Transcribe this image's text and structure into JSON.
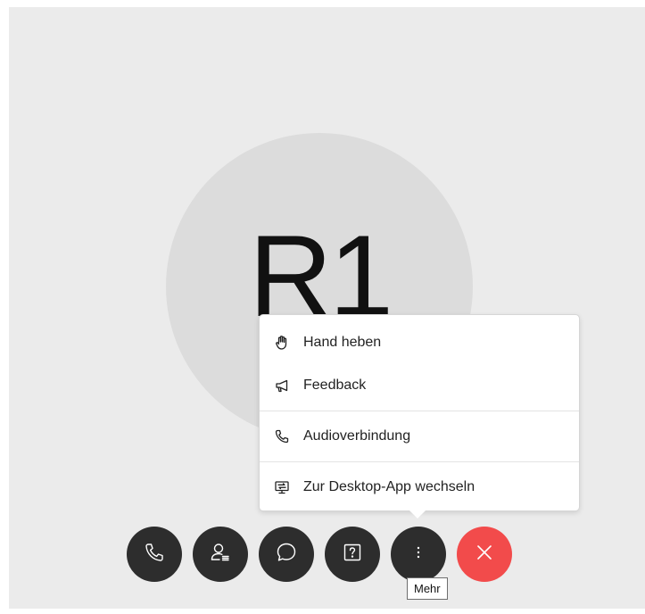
{
  "participant": {
    "initials": "R1"
  },
  "more_menu": {
    "items": [
      {
        "label": "Hand heben",
        "icon": "raise-hand-icon"
      },
      {
        "label": "Feedback",
        "icon": "megaphone-icon"
      },
      {
        "label": "Audioverbindung",
        "icon": "phone-icon"
      },
      {
        "label": "Zur Desktop-App wechseln",
        "icon": "desktop-app-icon"
      }
    ]
  },
  "toolbar": {
    "buttons": [
      {
        "name": "audio",
        "icon": "phone-icon"
      },
      {
        "name": "participants",
        "icon": "participants-icon"
      },
      {
        "name": "chat",
        "icon": "chat-bubble-icon"
      },
      {
        "name": "qa",
        "icon": "question-icon"
      },
      {
        "name": "more",
        "icon": "more-dots-icon"
      },
      {
        "name": "leave",
        "icon": "close-icon"
      }
    ],
    "leave_color": "#f24b4b",
    "button_color": "#2d2d2d"
  },
  "tooltip": {
    "text": "Mehr"
  }
}
